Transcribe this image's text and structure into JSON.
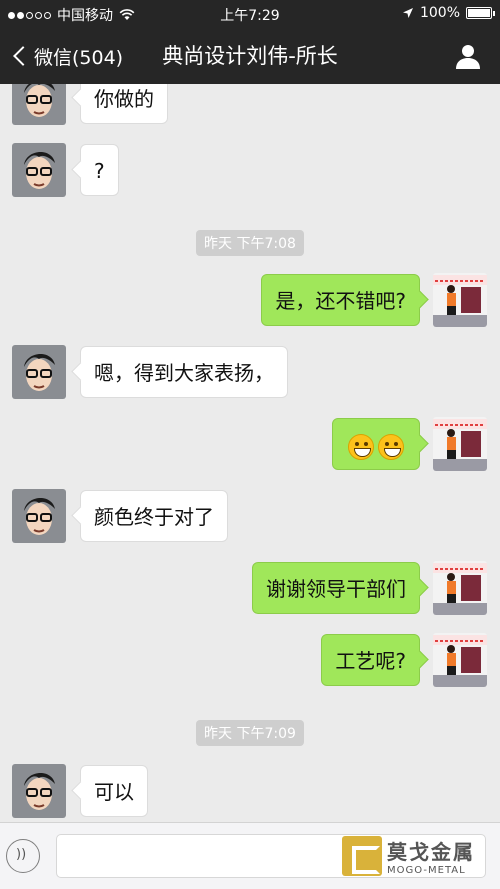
{
  "status_bar": {
    "carrier": "中国移动",
    "time": "上午7:29",
    "battery": "100%"
  },
  "nav": {
    "back_label": "微信(504)",
    "title": "典尚设计刘伟-所长"
  },
  "messages": [
    {
      "type": "in",
      "text": "你做的"
    },
    {
      "type": "in",
      "text": "?"
    },
    {
      "type": "timestamp",
      "text": "昨天 下午7:08"
    },
    {
      "type": "out",
      "text": "是，还不错吧?"
    },
    {
      "type": "in",
      "text": "嗯，得到大家表扬，"
    },
    {
      "type": "out",
      "emoji": "grinning-face"
    },
    {
      "type": "in",
      "text": "颜色终于对了"
    },
    {
      "type": "out",
      "text": "谢谢领导干部们"
    },
    {
      "type": "out",
      "text": "工艺呢?"
    },
    {
      "type": "timestamp",
      "text": "昨天 下午7:09"
    },
    {
      "type": "in",
      "text": "可以"
    }
  ],
  "input": {
    "voice_icon": "voice-icon",
    "placeholder": ""
  },
  "watermark": {
    "cn": "莫戈金属",
    "en": "MOGO-METAL"
  },
  "colors": {
    "outgoing_bubble": "#a0e75a",
    "incoming_bubble": "#ffffff",
    "background": "#ebebeb",
    "header": "#262626"
  }
}
